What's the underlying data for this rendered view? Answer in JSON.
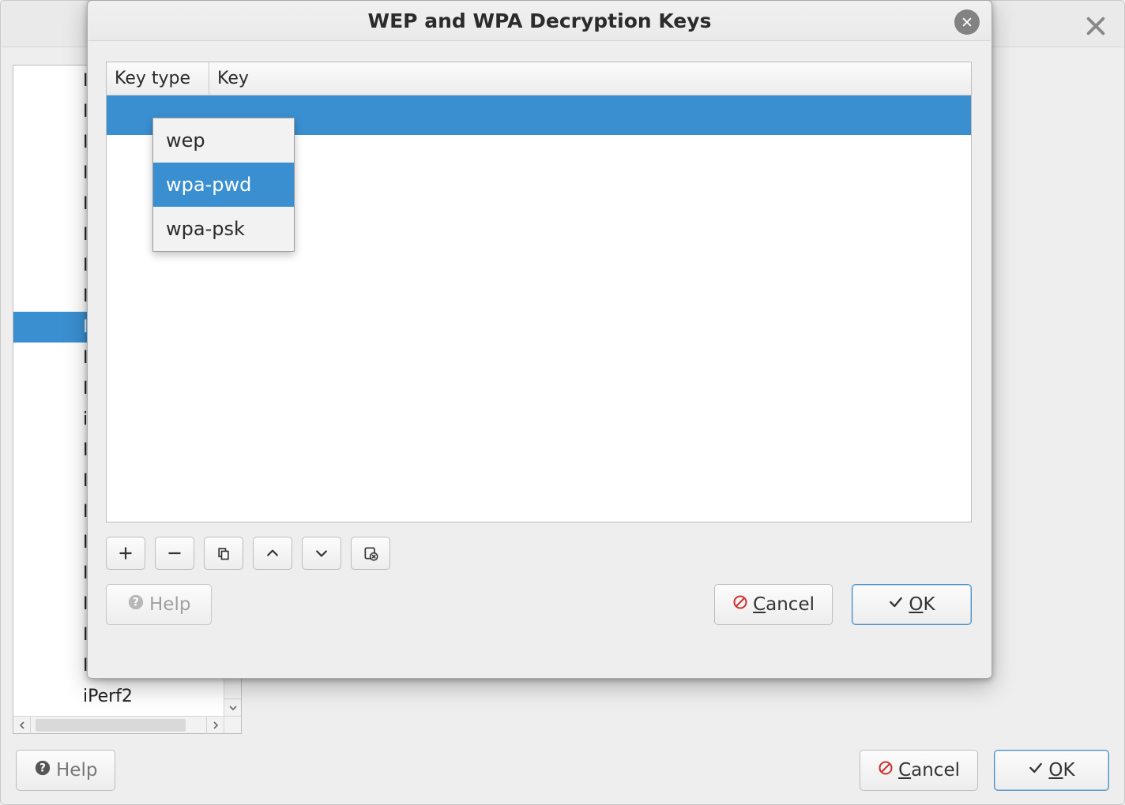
{
  "back_window": {
    "close_tooltip": "Close",
    "protocols": [
      {
        "label": "IA",
        "selected": false
      },
      {
        "label": "IA",
        "selected": false
      },
      {
        "label": "IB",
        "selected": false
      },
      {
        "label": "IC",
        "selected": false
      },
      {
        "label": "IC",
        "selected": false
      },
      {
        "label": "IC",
        "selected": false
      },
      {
        "label": "IC",
        "selected": false
      },
      {
        "label": "IC",
        "selected": false
      },
      {
        "label": "IE",
        "selected": true
      },
      {
        "label": "IE",
        "selected": false
      },
      {
        "label": "IE",
        "selected": false
      },
      {
        "label": "iF",
        "selected": false
      },
      {
        "label": "IL",
        "selected": false
      },
      {
        "label": "IN",
        "selected": false
      },
      {
        "label": "IN",
        "selected": false
      },
      {
        "label": "IN",
        "selected": false
      },
      {
        "label": "In",
        "selected": false
      },
      {
        "label": "In",
        "selected": false
      },
      {
        "label": "IP",
        "selected": false
      },
      {
        "label": "IPDR/SP",
        "selected": false
      },
      {
        "label": "iPerf2",
        "selected": false
      }
    ],
    "buttons": {
      "help": "Help",
      "cancel": "Cancel",
      "ok": "OK"
    }
  },
  "dialog": {
    "title": "WEP and WPA Decryption Keys",
    "columns": {
      "type": "Key type",
      "key": "Key"
    },
    "key_type_options": [
      {
        "value": "wep",
        "selected": false
      },
      {
        "value": "wpa-pwd",
        "selected": true
      },
      {
        "value": "wpa-psk",
        "selected": false
      }
    ],
    "toolbar": {
      "add": "plus-icon",
      "remove": "minus-icon",
      "copy": "copy-icon",
      "up": "chevron-up-icon",
      "down": "chevron-down-icon",
      "clear": "clear-icon"
    },
    "buttons": {
      "help": "Help",
      "cancel": "Cancel",
      "ok": "OK"
    }
  }
}
